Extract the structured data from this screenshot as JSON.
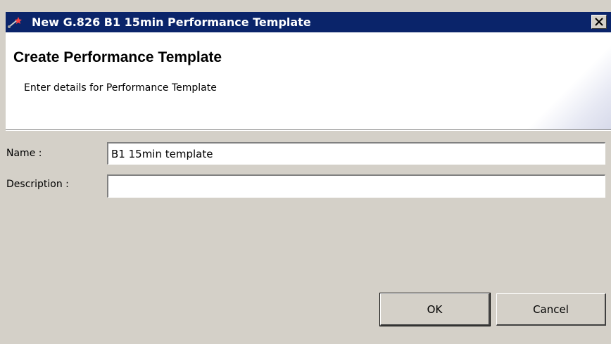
{
  "window": {
    "title": "New G.826 B1 15min Performance Template",
    "app_icon": "wizard-wand-icon",
    "close_icon": "close-icon"
  },
  "header": {
    "heading": "Create Performance Template",
    "subtitle": "Enter details for Performance Template"
  },
  "form": {
    "name": {
      "label": "Name :",
      "value": "B1 15min template"
    },
    "description": {
      "label": "Description :",
      "value": ""
    }
  },
  "buttons": {
    "ok_label": "OK",
    "cancel_label": "Cancel"
  },
  "colors": {
    "titlebar": "#0a246a",
    "dialog_background": "#d4d0c8",
    "header_background": "#ffffff"
  }
}
